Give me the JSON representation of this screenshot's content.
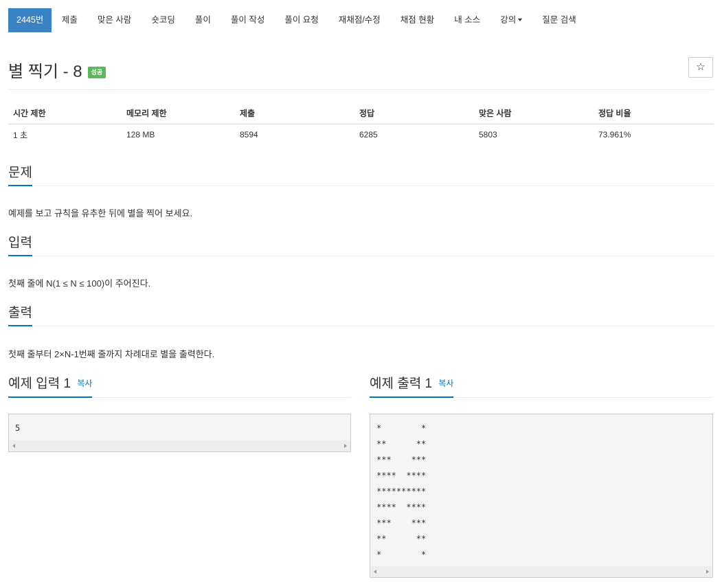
{
  "nav": {
    "items": [
      "2445번",
      "제출",
      "맞은 사람",
      "숏코딩",
      "풀이",
      "풀이 작성",
      "풀이 요청",
      "재채점/수정",
      "채점 현황",
      "내 소스",
      "강의",
      "질문 검색"
    ]
  },
  "problem": {
    "title": "별 찍기 - 8",
    "status_badge": "성공",
    "star_glyph": "☆"
  },
  "info": {
    "headers": [
      "시간 제한",
      "메모리 제한",
      "제출",
      "정답",
      "맞은 사람",
      "정답 비율"
    ],
    "values": [
      "1 초",
      "128 MB",
      "8594",
      "6285",
      "5803",
      "73.961%"
    ]
  },
  "sections": {
    "problem_heading": "문제",
    "problem_text": "예제를 보고 규칙을 유추한 뒤에 별을 찍어 보세요.",
    "input_heading": "입력",
    "input_text": "첫째 줄에 N(1 ≤ N ≤ 100)이 주어진다.",
    "output_heading": "출력",
    "output_text": "첫째 줄부터 2×N-1번째 줄까지 차례대로 별을 출력한다."
  },
  "samples": {
    "input_heading": "예제 입력 1",
    "output_heading": "예제 출력 1",
    "copy_label": "복사",
    "input_lines": [
      "5"
    ],
    "output_lines": [
      "*        *",
      "**      **",
      "***    ***",
      "****  ****",
      "**********",
      "****  ****",
      "***    ***",
      "**      **",
      "*        *"
    ]
  },
  "colors": {
    "active_tab": "#3a82c4",
    "success_badge": "#5cb85c",
    "accent_underline": "#0076c0"
  }
}
